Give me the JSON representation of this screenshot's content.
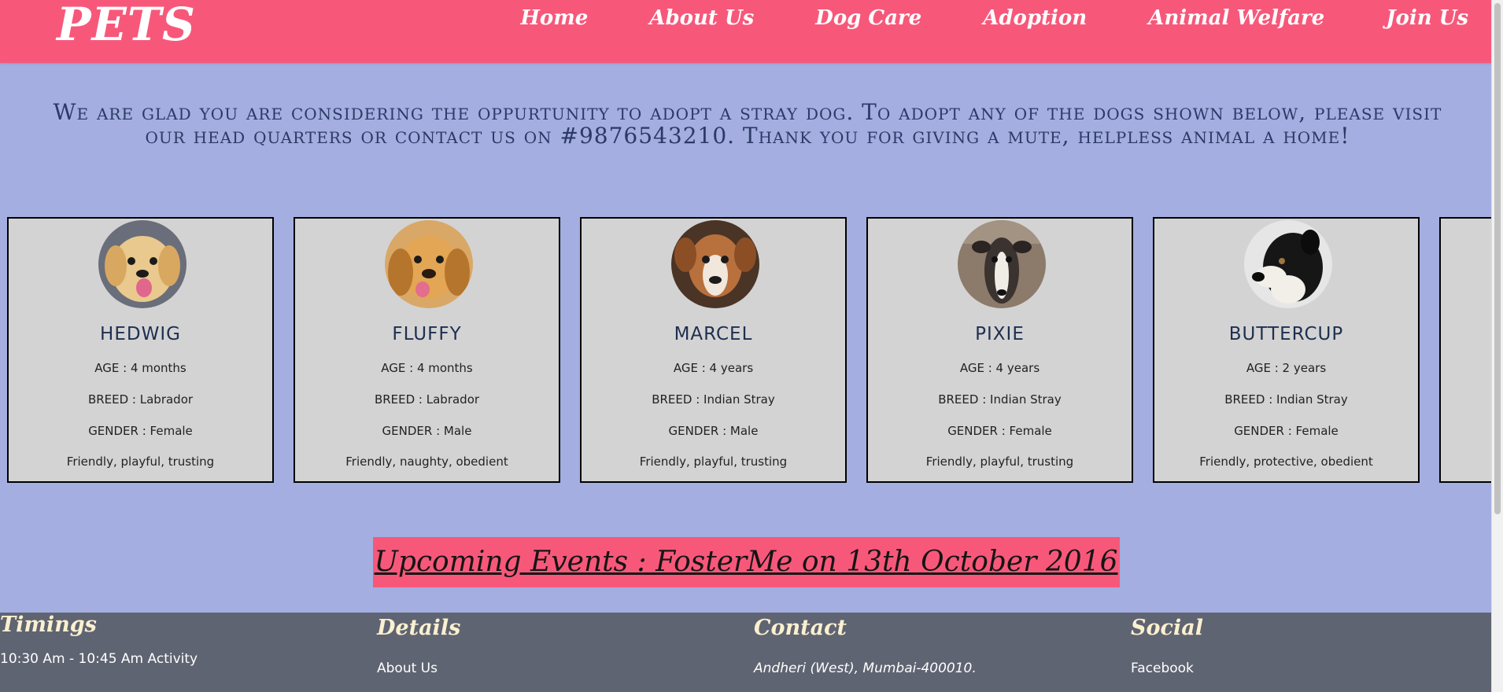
{
  "header": {
    "logo": "PETS",
    "nav": [
      "Home",
      "About Us",
      "Dog Care",
      "Adoption",
      "Animal Welfare",
      "Join Us"
    ]
  },
  "intro": "We are glad you are considering the oppurtunity to adopt a stray dog. To adopt any of the dogs shown below, please visit our head quarters or contact us on #9876543210. Thank you for giving a mute, helpless animal a home!",
  "dogs": [
    {
      "name": "HEDWIG",
      "age": "AGE : 4 months",
      "breed": "BREED : Labrador",
      "gender": "GENDER : Female",
      "traits": "Friendly, playful, trusting"
    },
    {
      "name": "FLUFFY",
      "age": "AGE : 4 months",
      "breed": "BREED : Labrador",
      "gender": "GENDER : Male",
      "traits": "Friendly, naughty, obedient"
    },
    {
      "name": "MARCEL",
      "age": "AGE : 4 years",
      "breed": "BREED : Indian Stray",
      "gender": "GENDER : Male",
      "traits": "Friendly, playful, trusting"
    },
    {
      "name": "PIXIE",
      "age": "AGE : 4 years",
      "breed": "BREED : Indian Stray",
      "gender": "GENDER : Female",
      "traits": "Friendly, playful, trusting"
    },
    {
      "name": "BUTTERCUP",
      "age": "AGE : 2 years",
      "breed": "BREED : Indian Stray",
      "gender": "GENDER : Female",
      "traits": "Friendly, protective, obedient"
    }
  ],
  "events": "Upcoming Events : FosterMe on 13th October 2016",
  "footer": {
    "timings": {
      "title": "Timings",
      "item": "10:30 Am - 10:45 Am Activity"
    },
    "details": {
      "title": "Details",
      "item": "About Us"
    },
    "contact": {
      "title": "Contact",
      "item": "Andheri (West), Mumbai-400010."
    },
    "social": {
      "title": "Social",
      "item": "Facebook"
    }
  },
  "colors": {
    "nav_bg": "#f7587a",
    "page_bg": "#a4aee0",
    "card_bg": "#d3d3d3",
    "footer_bg": "#5f6472",
    "footer_heading": "#fbf0cf"
  }
}
